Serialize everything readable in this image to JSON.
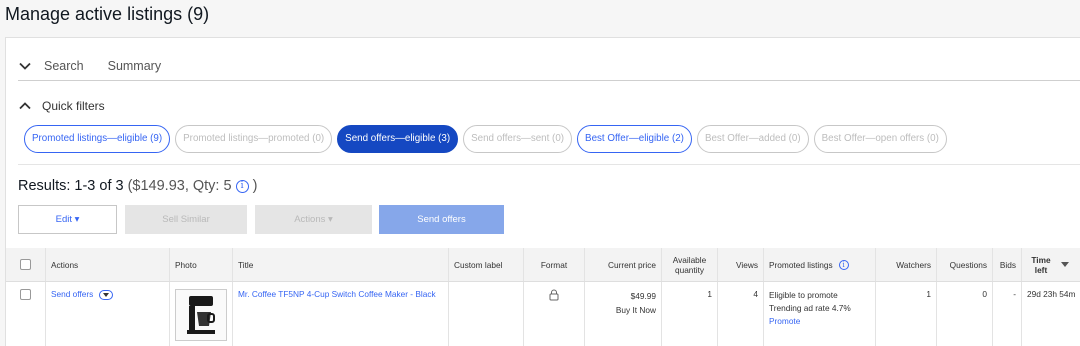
{
  "page": {
    "title": "Manage active listings (9)"
  },
  "tabs": {
    "search": "Search",
    "summary": "Summary"
  },
  "quick_filters": {
    "label": "Quick filters",
    "pills": [
      {
        "label": "Promoted listings—eligible (9)",
        "state": "outline"
      },
      {
        "label": "Promoted listings—promoted (0)",
        "state": "disabled"
      },
      {
        "label": "Send offers—eligible (3)",
        "state": "selected"
      },
      {
        "label": "Send offers—sent (0)",
        "state": "disabled"
      },
      {
        "label": "Best Offer—eligible (2)",
        "state": "outline"
      },
      {
        "label": "Best Offer—added (0)",
        "state": "disabled"
      },
      {
        "label": "Best Offer—open offers (0)",
        "state": "disabled"
      }
    ]
  },
  "results": {
    "label": "Results: 1-3 of 3",
    "meta": "($149.93, Qty: 5",
    "close": ")"
  },
  "toolbar": {
    "edit": "Edit ▾",
    "sell_similar": "Sell Similar",
    "actions": "Actions ▾",
    "send_offers": "Send offers"
  },
  "table": {
    "headers": {
      "actions": "Actions",
      "photo": "Photo",
      "title": "Title",
      "custom_label": "Custom label",
      "format": "Format",
      "current_price": "Current price",
      "available_quantity": "Available quantity",
      "views": "Views",
      "promoted_listings": "Promoted listings",
      "watchers": "Watchers",
      "questions": "Questions",
      "bids": "Bids",
      "time_left": "Time left"
    },
    "rows": [
      {
        "action": "Send offers",
        "title": "Mr. Coffee TF5NP 4-Cup Switch Coffee Maker - Black",
        "custom_label": "",
        "price": "$49.99",
        "price_format": "Buy It Now",
        "available_quantity": "1",
        "views": "4",
        "promo_status": "Eligible to promote",
        "promo_rate": "Trending ad rate 4.7%",
        "promo_link": "Promote",
        "watchers": "1",
        "questions": "0",
        "bids": "-",
        "time_left": "29d 23h 54m"
      }
    ]
  },
  "colors": {
    "accent": "#3665f3",
    "selected_pill": "#1548c2",
    "send_button": "#86a7ea"
  },
  "icons": {
    "collapse": "chevron-down-icon",
    "expand": "chevron-up-icon",
    "info": "info-icon",
    "format": "lock-icon"
  }
}
